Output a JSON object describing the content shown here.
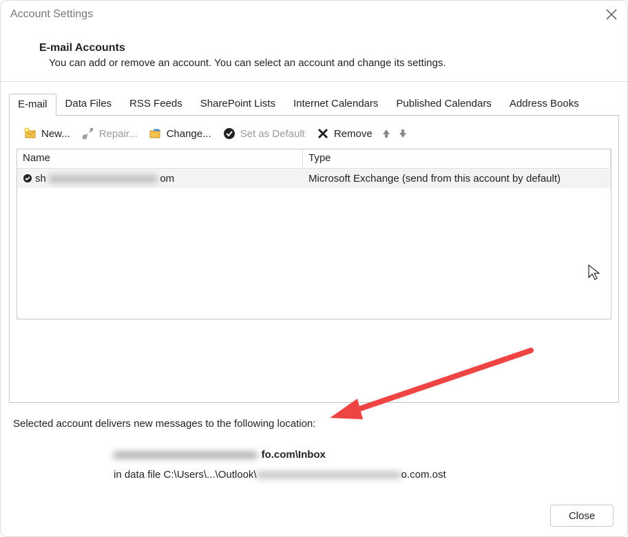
{
  "window": {
    "title": "Account Settings"
  },
  "header": {
    "title": "E-mail Accounts",
    "subtitle": "You can add or remove an account. You can select an account and change its settings."
  },
  "tabs": [
    {
      "id": "email",
      "label": "E-mail",
      "active": true
    },
    {
      "id": "datafiles",
      "label": "Data Files"
    },
    {
      "id": "rss",
      "label": "RSS Feeds"
    },
    {
      "id": "sharepoint",
      "label": "SharePoint Lists"
    },
    {
      "id": "ical",
      "label": "Internet Calendars"
    },
    {
      "id": "pubcal",
      "label": "Published Calendars"
    },
    {
      "id": "addr",
      "label": "Address Books"
    }
  ],
  "toolbar": {
    "new": "New...",
    "repair": "Repair...",
    "change": "Change...",
    "set_default": "Set as Default",
    "remove": "Remove"
  },
  "grid": {
    "columns": {
      "name": "Name",
      "type": "Type"
    },
    "rows": [
      {
        "name_prefix": "sh",
        "name_blur": "xxxxxxxxxxxxxxxxxxxxx",
        "name_suffix": "om",
        "type": "Microsoft Exchange (send from this account by default)",
        "default": true
      }
    ]
  },
  "delivery": {
    "intro": "Selected account delivers new messages to the following location:",
    "location_blur": "xxxxxxxxxxxxxxxxxxxxxxxxx",
    "location_suffix": "fo.com\\Inbox",
    "path_prefix": "in data file C:\\Users\\...\\Outlook\\",
    "path_blur": "xxxxxxxxxxxxxxxxxxxxxxxxxxxx",
    "path_suffix": "o.com.ost"
  },
  "footer": {
    "close": "Close"
  }
}
